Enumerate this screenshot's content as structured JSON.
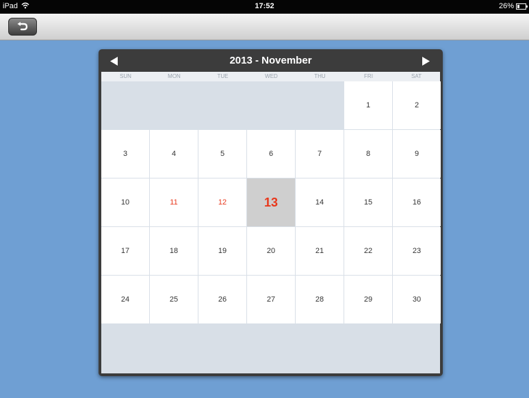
{
  "status_bar": {
    "device": "iPad",
    "time": "17:52",
    "battery": "26%"
  },
  "nav": {
    "back_icon": "back-arrow-icon"
  },
  "calendar": {
    "title": "2013 - November",
    "weekdays": [
      "SUN",
      "MON",
      "TUE",
      "WED",
      "THU",
      "FRI",
      "SAT"
    ],
    "weeks": [
      [
        "",
        "",
        "",
        "",
        "",
        "1",
        "2"
      ],
      [
        "3",
        "4",
        "5",
        "6",
        "7",
        "8",
        "9"
      ],
      [
        "10",
        "11",
        "12",
        "13",
        "14",
        "15",
        "16"
      ],
      [
        "17",
        "18",
        "19",
        "20",
        "21",
        "22",
        "23"
      ],
      [
        "24",
        "25",
        "26",
        "27",
        "28",
        "29",
        "30"
      ]
    ],
    "highlighted_red_days": [
      "11",
      "12"
    ],
    "today": "13",
    "colors": {
      "accent_red": "#e8381c",
      "today_bg": "#cfcfcf",
      "frame": "#3c3c3c",
      "background": "#6f9fd3"
    }
  }
}
